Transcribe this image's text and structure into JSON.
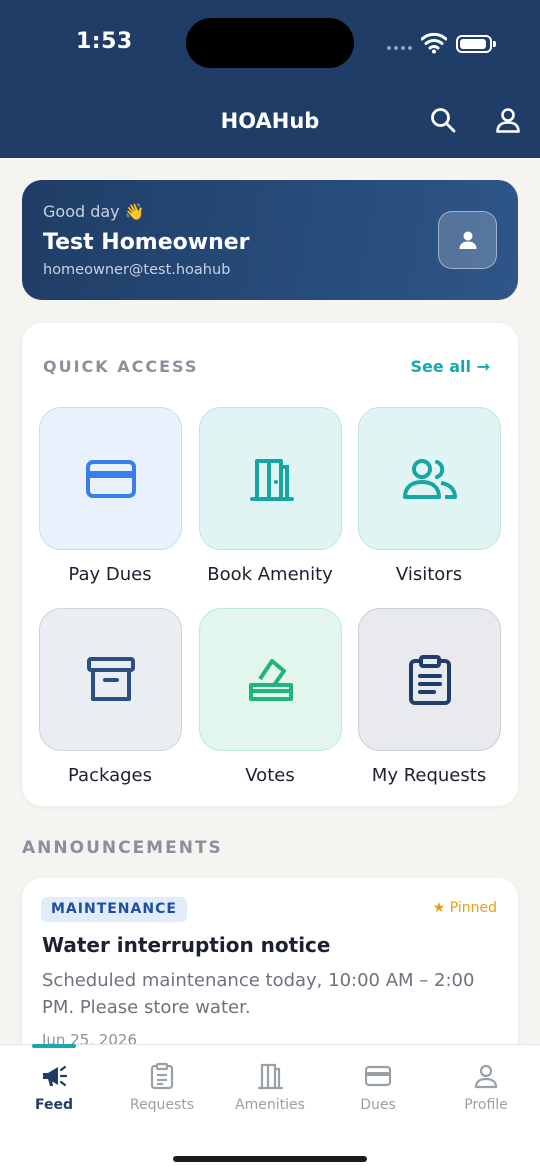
{
  "status_bar": {
    "time": "1:53"
  },
  "header": {
    "title": "HOAHub",
    "search_icon": "search-icon",
    "profile_icon": "user-icon"
  },
  "greeting": {
    "salutation": "Good day 👋",
    "name": "Test Homeowner",
    "email": "homeowner@test.hoahub"
  },
  "quick_access": {
    "title": "QUICK ACCESS",
    "see_all": "See all →",
    "tiles": [
      {
        "label": "Pay Dues",
        "icon": "credit-card-icon",
        "bg": "#e9f1fd",
        "fg": "#3a7ee8"
      },
      {
        "label": "Book Amenity",
        "icon": "door-icon",
        "bg": "#e0f5f3",
        "fg": "#16a6a6"
      },
      {
        "label": "Visitors",
        "icon": "users-icon",
        "bg": "#e0f5f3",
        "fg": "#16a6a6"
      },
      {
        "label": "Packages",
        "icon": "archive-box-icon",
        "bg": "#eaedf2",
        "fg": "#2a4f82"
      },
      {
        "label": "Votes",
        "icon": "ballot-icon",
        "bg": "#e2f6ee",
        "fg": "#1eb57a"
      },
      {
        "label": "My Requests",
        "icon": "clipboard-icon",
        "bg": "#e8eaee",
        "fg": "#1f3d66"
      }
    ]
  },
  "announcements": {
    "title": "ANNOUNCEMENTS",
    "items": [
      {
        "category": "MAINTENANCE",
        "pinned": "Pinned",
        "headline": "Water interruption notice",
        "body": "Scheduled maintenance today, 10:00 AM – 2:00 PM. Please store water.",
        "date": "Jun 25, 2026"
      }
    ]
  },
  "tabbar": {
    "tabs": [
      {
        "label": "Feed",
        "icon": "megaphone-icon",
        "active": true
      },
      {
        "label": "Requests",
        "icon": "clipboard-icon",
        "active": false
      },
      {
        "label": "Amenities",
        "icon": "door-icon",
        "active": false
      },
      {
        "label": "Dues",
        "icon": "credit-card-icon",
        "active": false
      },
      {
        "label": "Profile",
        "icon": "user-icon",
        "active": false
      }
    ]
  },
  "colors": {
    "primary": "#1f3d66",
    "accent": "#18a8b0",
    "background": "#f6f4f1",
    "pinned": "#e6a011"
  }
}
